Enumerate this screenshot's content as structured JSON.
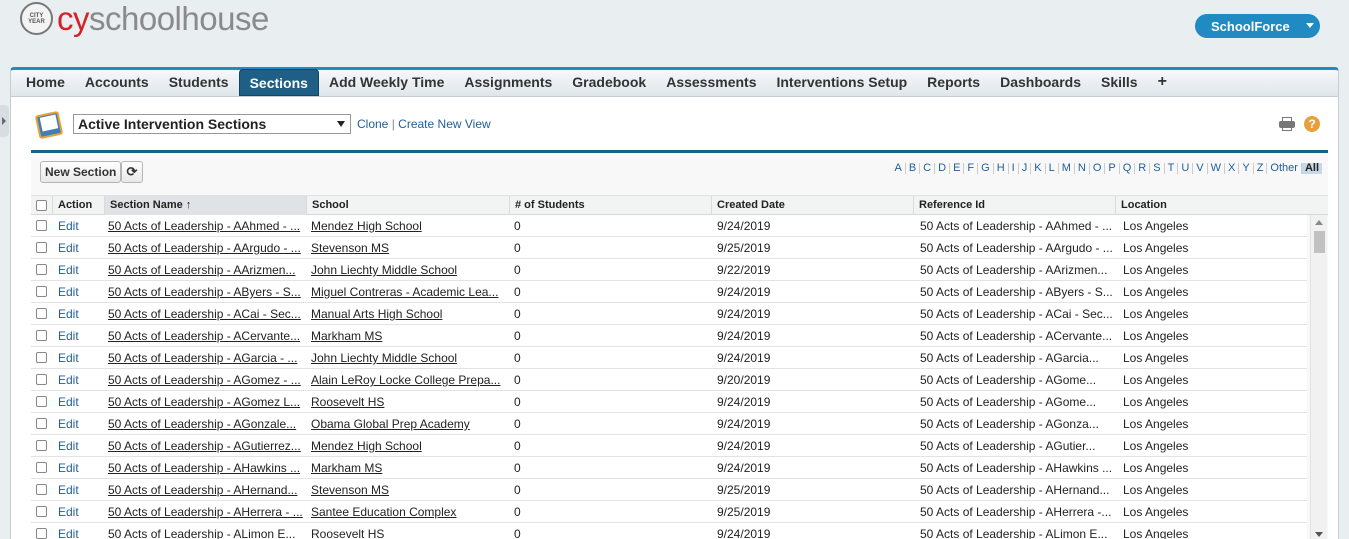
{
  "header": {
    "logo_seal": "CITY YEAR",
    "brand_prefix": "cy",
    "brand_suffix": "schoolhouse",
    "app_switcher": "SchoolForce"
  },
  "tabs": [
    {
      "label": "Home"
    },
    {
      "label": "Accounts"
    },
    {
      "label": "Students"
    },
    {
      "label": "Sections",
      "active": true
    },
    {
      "label": "Add Weekly Time"
    },
    {
      "label": "Assignments"
    },
    {
      "label": "Gradebook"
    },
    {
      "label": "Assessments"
    },
    {
      "label": "Interventions Setup"
    },
    {
      "label": "Reports"
    },
    {
      "label": "Dashboards"
    },
    {
      "label": "Skills"
    },
    {
      "label": "+"
    }
  ],
  "view": {
    "selected": "Active Intervention Sections",
    "clone": "Clone",
    "separator": "|",
    "create_new": "Create New View"
  },
  "help_icon": "?",
  "toolbar": {
    "new_section": "New Section",
    "refresh_icon": "⟳"
  },
  "alphabet": [
    "A",
    "B",
    "C",
    "D",
    "E",
    "F",
    "G",
    "H",
    "I",
    "J",
    "K",
    "L",
    "M",
    "N",
    "O",
    "P",
    "Q",
    "R",
    "S",
    "T",
    "U",
    "V",
    "W",
    "X",
    "Y",
    "Z",
    "Other",
    "All"
  ],
  "columns": {
    "action": "Action",
    "section_name": "Section Name ↑",
    "school": "School",
    "students": "# of Students",
    "created": "Created Date",
    "reference": "Reference Id",
    "location": "Location"
  },
  "rows": [
    {
      "action": "Edit",
      "name": "50 Acts of Leadership - AAhmed - ...",
      "school": "Mendez High School",
      "students": "0",
      "created": "9/24/2019",
      "reference": "50 Acts of Leadership - AAhmed - ...",
      "location": "Los Angeles"
    },
    {
      "action": "Edit",
      "name": "50 Acts of Leadership - AArgudo - ...",
      "school": "Stevenson MS",
      "students": "0",
      "created": "9/25/2019",
      "reference": "50 Acts of Leadership - AArgudo - ...",
      "location": "Los Angeles"
    },
    {
      "action": "Edit",
      "name": "50 Acts of Leadership - AArizmen...",
      "school": "John Liechty Middle School",
      "students": "0",
      "created": "9/22/2019",
      "reference": "50 Acts of Leadership - AArizmen...",
      "location": "Los Angeles"
    },
    {
      "action": "Edit",
      "name": "50 Acts of Leadership - AByers - S...",
      "school": "Miguel Contreras - Academic Lea...",
      "students": "0",
      "created": "9/24/2019",
      "reference": "50 Acts of Leadership - AByers - S...",
      "location": "Los Angeles"
    },
    {
      "action": "Edit",
      "name": "50 Acts of Leadership - ACai - Sec...",
      "school": "Manual Arts High School",
      "students": "0",
      "created": "9/24/2019",
      "reference": "50 Acts of Leadership - ACai - Sec...",
      "location": "Los Angeles"
    },
    {
      "action": "Edit",
      "name": "50 Acts of Leadership - ACervante...",
      "school": "Markham MS",
      "students": "0",
      "created": "9/24/2019",
      "reference": "50 Acts of Leadership - ACervante...",
      "location": "Los Angeles"
    },
    {
      "action": "Edit",
      "name": "50 Acts of Leadership - AGarcia - ...",
      "school": "John Liechty Middle School",
      "students": "0",
      "created": "9/24/2019",
      "reference": "50 Acts of Leadership - AGarcia...",
      "location": "Los Angeles"
    },
    {
      "action": "Edit",
      "name": "50 Acts of Leadership - AGomez - ...",
      "school": "Alain LeRoy Locke College Prepa...",
      "students": "0",
      "created": "9/20/2019",
      "reference": "50 Acts of Leadership - AGome...",
      "location": "Los Angeles"
    },
    {
      "action": "Edit",
      "name": "50 Acts of Leadership - AGomez L...",
      "school": "Roosevelt HS",
      "students": "0",
      "created": "9/24/2019",
      "reference": "50 Acts of Leadership - AGome...",
      "location": "Los Angeles"
    },
    {
      "action": "Edit",
      "name": "50 Acts of Leadership - AGonzale...",
      "school": "Obama Global Prep Academy",
      "students": "0",
      "created": "9/24/2019",
      "reference": "50 Acts of Leadership - AGonza...",
      "location": "Los Angeles"
    },
    {
      "action": "Edit",
      "name": "50 Acts of Leadership - AGutierrez...",
      "school": "Mendez High School",
      "students": "0",
      "created": "9/24/2019",
      "reference": "50 Acts of Leadership - AGutier...",
      "location": "Los Angeles"
    },
    {
      "action": "Edit",
      "name": "50 Acts of Leadership - AHawkins ...",
      "school": "Markham MS",
      "students": "0",
      "created": "9/24/2019",
      "reference": "50 Acts of Leadership - AHawkins ...",
      "location": "Los Angeles"
    },
    {
      "action": "Edit",
      "name": "50 Acts of Leadership - AHernand...",
      "school": "Stevenson MS",
      "students": "0",
      "created": "9/25/2019",
      "reference": "50 Acts of Leadership - AHernand...",
      "location": "Los Angeles"
    },
    {
      "action": "Edit",
      "name": "50 Acts of Leadership - AHerrera - ...",
      "school": "Santee Education Complex",
      "students": "0",
      "created": "9/25/2019",
      "reference": "50 Acts of Leadership - AHerrera -...",
      "location": "Los Angeles"
    },
    {
      "action": "Edit",
      "name": "50 Acts of Leadership - ALimon E...",
      "school": "Roosevelt HS",
      "students": "0",
      "created": "9/24/2019",
      "reference": "50 Acts of Leadership - ALimon E...",
      "location": "Los Angeles"
    }
  ]
}
